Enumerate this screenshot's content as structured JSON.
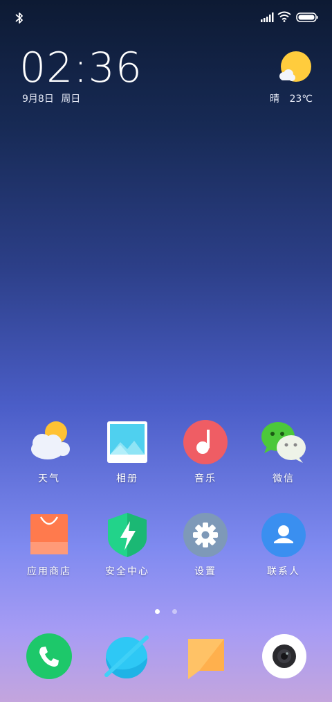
{
  "clock": {
    "time": "02:36",
    "date": "9月8日 周日"
  },
  "weather": {
    "condition": "晴",
    "temperature": "23℃"
  },
  "apps": [
    {
      "id": "weather",
      "label": "天气",
      "icon": "weather-icon"
    },
    {
      "id": "gallery",
      "label": "相册",
      "icon": "gallery-icon"
    },
    {
      "id": "music",
      "label": "音乐",
      "icon": "music-icon"
    },
    {
      "id": "wechat",
      "label": "微信",
      "icon": "wechat-icon"
    },
    {
      "id": "app-store",
      "label": "应用商店",
      "icon": "shopping-bag-icon"
    },
    {
      "id": "security",
      "label": "安全中心",
      "icon": "shield-icon"
    },
    {
      "id": "settings",
      "label": "设置",
      "icon": "gear-icon"
    },
    {
      "id": "contacts",
      "label": "联系人",
      "icon": "contact-icon"
    }
  ],
  "dock": [
    {
      "id": "phone",
      "icon": "phone-icon"
    },
    {
      "id": "browser",
      "icon": "browser-icon"
    },
    {
      "id": "messages",
      "icon": "message-icon"
    },
    {
      "id": "camera",
      "icon": "camera-icon"
    }
  ],
  "page_indicator": {
    "count": 2,
    "active": 1
  },
  "colors": {
    "phone": "#1dc86a",
    "browser": "#2ec8f5",
    "messages": "#ffc266",
    "music": "#ef5d64",
    "security": "#22d38a",
    "settings": "#7e99b8",
    "contacts": "#3a8ff0",
    "store": "#ff7a4d"
  }
}
